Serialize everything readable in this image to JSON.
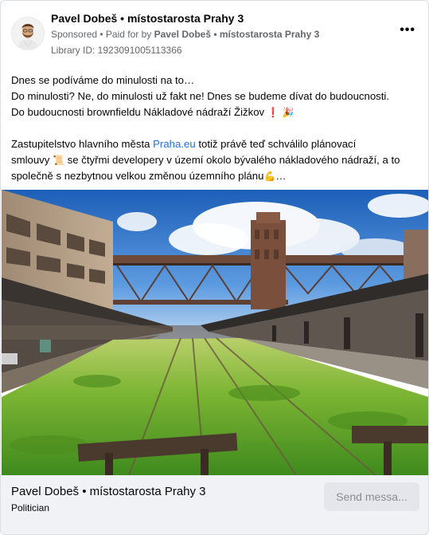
{
  "post": {
    "page_name": "Pavel Dobeš • místostarosta Prahy 3",
    "sponsored_label": "Sponsored",
    "paid_prefix": " • Paid for by ",
    "paid_by": "Pavel Dobeš • místostarosta Prahy 3",
    "library_id": "Library ID: 1923091005113366",
    "more_icon": "more-dots-icon",
    "text": {
      "line1": "Dnes se podíváme do minulosti na to…",
      "line2": "Do minulosti? Ne, do minulosti už fakt ne! Dnes se budeme dívat do budoucnosti.",
      "line3": "Do budoucnosti brownfieldu Nákladové nádraží Žižkov",
      "line3_emoji1": "❗",
      "line3_emoji2": "🎉",
      "line4_before": "Zastupitelstvo hlavního města ",
      "line4_link": "Praha.eu",
      "line4_after": " totiž právě teď schválilo plánovací",
      "line5_before": "smlouvy ",
      "line5_emoji": "📜",
      "line5_after": " se čtyřmi developery v území okolo bývalého nákladového nádraží, a to",
      "line6_before": "společně s nezbytnou velkou změnou územního plánu",
      "line6_emoji": "💪",
      "line6_after": "…"
    },
    "image_subject": "abandoned-freight-station-photo"
  },
  "footer": {
    "name": "Pavel Dobeš • místostarosta Prahy 3",
    "category": "Politician",
    "send_button": "Send messa..."
  },
  "colors": {
    "link": "#216fdb",
    "muted": "#65676b",
    "footer_bg": "#f0f2f5",
    "button_bg": "#e4e6eb"
  }
}
